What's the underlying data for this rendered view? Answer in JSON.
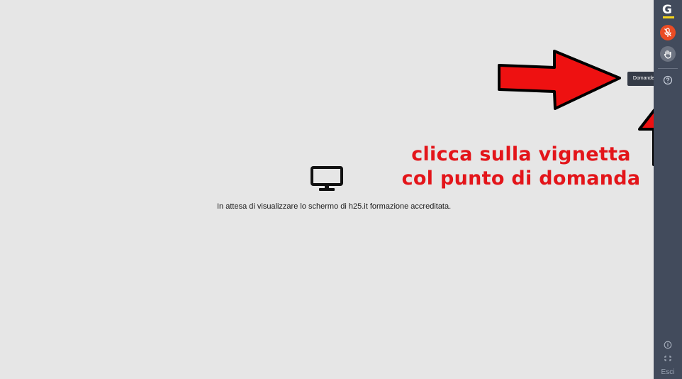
{
  "main": {
    "waiting_message": "In attesa di visualizzare lo schermo di h25.it formazione accreditata.",
    "monitor_icon": "monitor-icon"
  },
  "annotation": {
    "line1": "clicca sulla vignetta",
    "line2": "col punto di domanda",
    "color": "#e3151a"
  },
  "sidebar": {
    "logo_letter": "G",
    "buttons": [
      {
        "icon": "microphone-muted-icon",
        "color": "#ea4c24"
      },
      {
        "icon": "raise-hand-icon",
        "color": "#6c7381"
      },
      {
        "icon": "question-bubble-icon"
      }
    ],
    "tooltip": "Domande",
    "bottom_icons": [
      "info-icon",
      "fullscreen-icon"
    ],
    "exit_label": "Esci",
    "background": "#424b5c"
  }
}
